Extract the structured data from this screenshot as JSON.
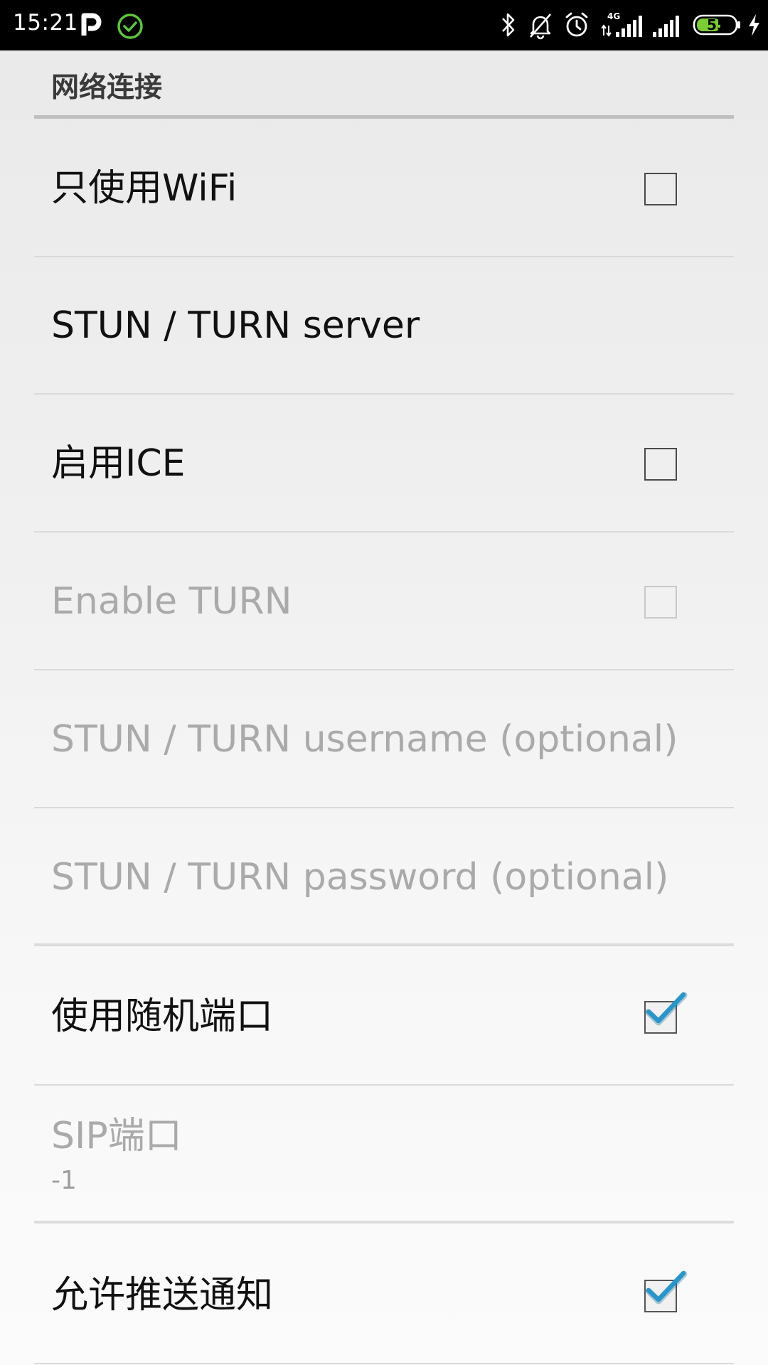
{
  "status_bar": {
    "time": "15:21",
    "battery_level": "55",
    "icons": [
      "p-app-icon",
      "check-circle-icon",
      "bluetooth-icon",
      "notifications-muted-icon",
      "alarm-icon",
      "signal-4g-icon",
      "signal-icon",
      "battery-icon",
      "charging-icon"
    ],
    "colors": {
      "background": "#000000",
      "check_icon": "#5ec43f",
      "battery_fill": "#7ccd35"
    }
  },
  "section": {
    "title": "网络连接"
  },
  "preferences": [
    {
      "title": "只使用WiFi",
      "type": "checkbox",
      "checked": false,
      "enabled": true
    },
    {
      "title": "STUN / TURN server",
      "type": "text",
      "enabled": true
    },
    {
      "title": "启用ICE",
      "type": "checkbox",
      "checked": false,
      "enabled": true
    },
    {
      "title": "Enable TURN",
      "type": "checkbox",
      "checked": false,
      "enabled": false
    },
    {
      "title": "STUN / TURN username (optional)",
      "type": "text",
      "enabled": false
    },
    {
      "title": "STUN / TURN password (optional)",
      "type": "text",
      "enabled": false
    },
    {
      "title": "使用随机端口",
      "type": "checkbox",
      "checked": true,
      "enabled": true
    },
    {
      "title": "SIP端口",
      "summary": "-1",
      "type": "text",
      "enabled": false
    },
    {
      "title": "允许推送通知",
      "type": "checkbox",
      "checked": true,
      "enabled": true
    }
  ],
  "colors": {
    "checkmark": "#2a95c8",
    "enabled_text": "#111111",
    "disabled_text": "#aaaaaa",
    "divider": "#dadada"
  }
}
